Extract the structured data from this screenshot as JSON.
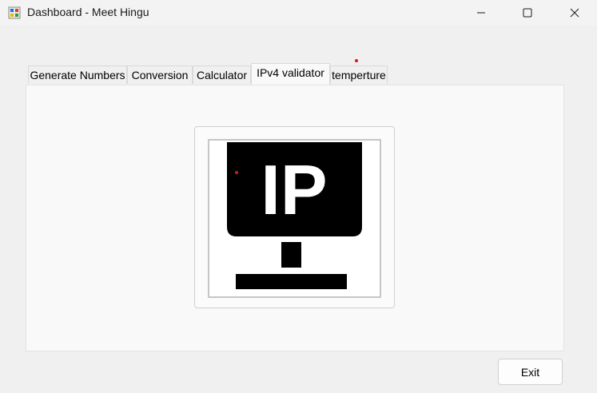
{
  "window": {
    "title": "Dashboard - Meet Hingu",
    "app_icon": "winforms-app-icon",
    "controls": {
      "minimize_icon": "minimize-icon",
      "maximize_icon": "maximize-icon",
      "close_icon": "close-icon"
    }
  },
  "tabs": [
    {
      "label": "Generate Numbers",
      "selected": false
    },
    {
      "label": "Conversion",
      "selected": false
    },
    {
      "label": "Calculator",
      "selected": false
    },
    {
      "label": "IPv4 validator",
      "selected": true
    },
    {
      "label": "temperture",
      "selected": false
    }
  ],
  "main": {
    "picture": {
      "text": "IP",
      "icon": "ip-monitor-icon"
    }
  },
  "footer": {
    "exit_label": "Exit"
  },
  "colors": {
    "window_bg": "#f0f0f0",
    "panel_bg": "#f9f9f9",
    "marker_red": "#e0141a"
  }
}
